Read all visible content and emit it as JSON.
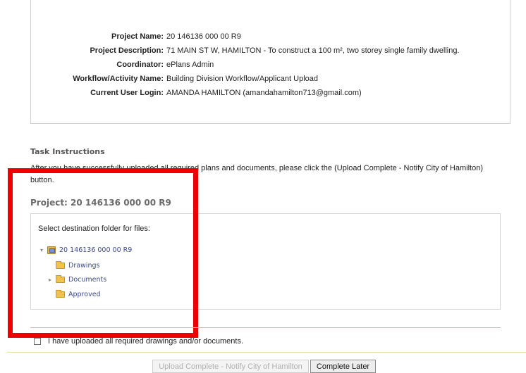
{
  "project_info": {
    "rows": [
      {
        "label": "Project Name:",
        "value": "20 146136 000 00 R9"
      },
      {
        "label": "Project Description:",
        "value": "71 MAIN ST W, HAMILTON - To construct a 100 m², two storey single family dwelling."
      },
      {
        "label": "Coordinator:",
        "value": "ePlans Admin"
      },
      {
        "label": "Workflow/Activity Name:",
        "value": "Building Division Workflow/Applicant Upload"
      },
      {
        "label": "Current User Login:",
        "value": "AMANDA HAMILTON (amandahamilton713@gmail.com)"
      }
    ]
  },
  "task": {
    "heading": "Task Instructions",
    "text": "After you have successfully uploaded all required plans and documents, please click the (Upload Complete - Notify City of Hamilton) button."
  },
  "project_heading": "Project: 20 146136 000 00 R9",
  "destination": {
    "label": "Select destination folder for files:",
    "tree": {
      "root": "20 146136 000 00 R9",
      "items": [
        "Drawings",
        "Documents",
        "Approved"
      ]
    }
  },
  "confirm_label": "I have uploaded all required drawings and/or documents.",
  "buttons": {
    "upload_complete": "Upload Complete - Notify City of Hamilton",
    "complete_later": "Complete Later"
  },
  "annotation_color": "#ee0000"
}
